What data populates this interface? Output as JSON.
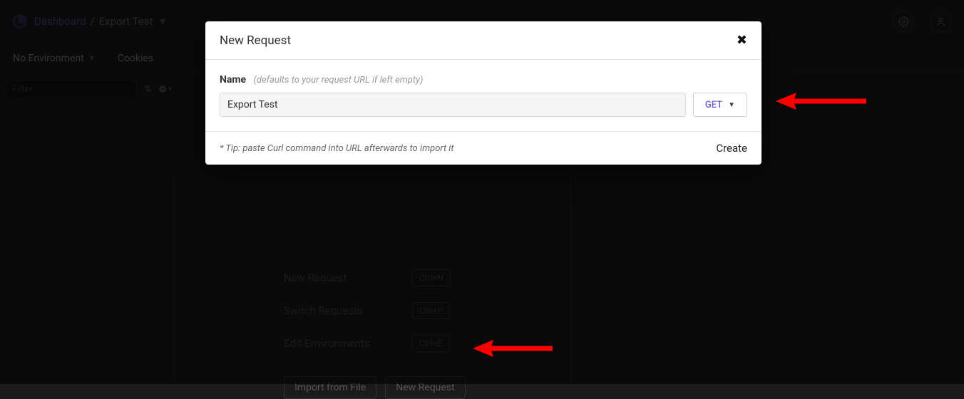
{
  "topbar": {
    "breadcrumb": {
      "dashboard": "Dashboard",
      "sep": "/",
      "workspace": "Export Test"
    }
  },
  "sidebar": {
    "env_label": "No Environment",
    "cookies_label": "Cookies",
    "filter_placeholder": "Filter"
  },
  "shortcuts": {
    "new_request": {
      "label": "New Request",
      "kbd": "Ctrl+N"
    },
    "switch_requests": {
      "label": "Switch Requests",
      "kbd": "Ctrl+P"
    },
    "edit_environments": {
      "label": "Edit Environments",
      "kbd": "Ctrl+E"
    }
  },
  "empty_actions": {
    "import": "Import from File",
    "new_request": "New Request"
  },
  "modal": {
    "title": "New Request",
    "name_label": "Name",
    "name_hint": "(defaults to your request URL if left empty)",
    "name_value": "Export Test",
    "method": "GET",
    "tip": "* Tip: paste Curl command into URL afterwards to import it",
    "create": "Create"
  }
}
